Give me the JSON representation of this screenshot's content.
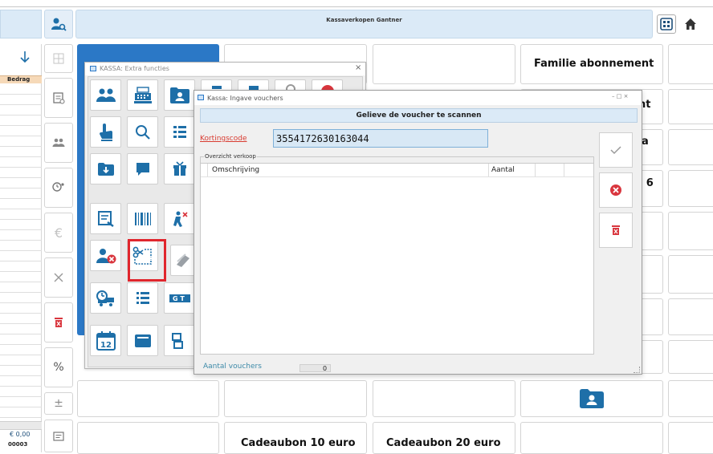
{
  "colors": {
    "accent": "#2b78c6",
    "dark_blue": "#1e6fa8",
    "red": "#d9363e",
    "teal": "#3d8aa8"
  },
  "topbar": {
    "title": "Kassaverkopen Gantner"
  },
  "left_grid": {
    "header": "Bedrag",
    "total": "€ 0,00",
    "code": "00003"
  },
  "tiles": {
    "familie": "Familie abonnement",
    "hidden_1": "nt",
    "hidden_2": "a",
    "hidden_3": ": 6",
    "cadeau_10": "Cadeaubon 10 euro",
    "cadeau_20": "Cadeaubon 20  euro"
  },
  "extra_window": {
    "title": "KASSA: Extra functies",
    "close": "×"
  },
  "voucher_window": {
    "title": "Kassa: Ingave vouchers",
    "controls": "– □ ×",
    "banner": "Gelieve de voucher te scannen",
    "code_label": "Kortingscode",
    "code_value": "3554172630163044",
    "group_label": "Overzicht verkoop",
    "col_description": "Omschrijving",
    "col_quantity": "Aantal",
    "count_label": "Aantal vouchers",
    "count_value": "0"
  },
  "icons": [
    "user-search-icon",
    "home-icon",
    "grid-view-icon",
    "arrow-down-icon",
    "table-icon",
    "receipt-icon",
    "users-icon",
    "clock-user-icon",
    "euro-icon",
    "close-x-icon",
    "trash-icon",
    "percent-icon",
    "plus-minus-icon",
    "comment-icon"
  ]
}
